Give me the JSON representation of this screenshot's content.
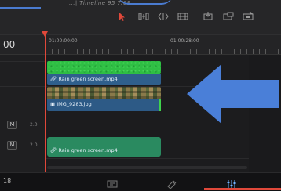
{
  "header": {
    "breadcrumb": "...| Timeline 95 7/09..."
  },
  "toolbar": {
    "icons": [
      "cursor-icon",
      "trim-icon",
      "split-icon",
      "blade-icon",
      "insert-icon",
      "overwrite-icon",
      "replace-icon"
    ],
    "accent": "#e0483a"
  },
  "timeline": {
    "timecode": "00",
    "ruler_left_tc": "01:00:00:00",
    "ruler_right_tc": "01:00:28:00",
    "video_clips": [
      {
        "name": "Rain green screen.mp4",
        "color": "#2f5f8c"
      },
      {
        "name": "IMG_9283.jpg",
        "color": "#2d5a86"
      }
    ],
    "audio_tracks": [
      {
        "mute_label": "M",
        "volume": "2.0"
      },
      {
        "mute_label": "M",
        "volume": "2.0"
      }
    ],
    "audio_clip": {
      "name": "Rain green screen.mp4",
      "color": "#2a8a60"
    },
    "playhead_color": "#e0483a"
  },
  "footer": {
    "page_num": "18",
    "icons": [
      "media-icon",
      "edit-icon",
      "mixer-icon"
    ]
  },
  "annotation": {
    "arrow_color": "#4a7fd8"
  }
}
